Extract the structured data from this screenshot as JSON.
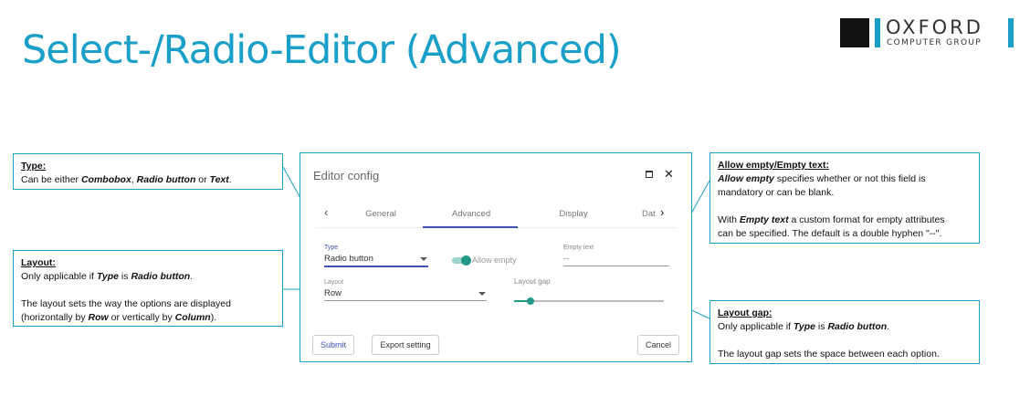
{
  "slide": {
    "title": "Select-/Radio-Editor (Advanced)"
  },
  "logo": {
    "name": "OXFORD",
    "subtitle": "COMPUTER GROUP"
  },
  "callouts": {
    "type": {
      "title": "Type:",
      "t1": "Can be either ",
      "e1": "Combobox",
      "t2": ", ",
      "e2": "Radio button",
      "t3": " or ",
      "e3": "Text",
      "t4": "."
    },
    "layout": {
      "title": "Layout:",
      "l1a": "Only applicable if ",
      "l1b": "Type",
      "l1c": " is ",
      "l1d": "Radio button",
      "l1e": ".",
      "l2": "The layout sets the way the options are displayed",
      "l3a": "(horizontally by ",
      "l3b": "Row",
      "l3c": " or vertically by ",
      "l3d": "Column",
      "l3e": ")."
    },
    "allow_empty": {
      "title": "Allow empty/Empty text:",
      "l1a": "Allow empty",
      "l1b": " specifies whether or not this field is",
      "l2": "mandatory or can be blank.",
      "l3a": "With ",
      "l3b": "Empty text",
      "l3c": " a custom format for empty attributes",
      "l4": "can be specified. The default is a double hyphen \"--\"."
    },
    "layout_gap": {
      "title": "Layout gap:",
      "l1a": "Only applicable if ",
      "l1b": "Type",
      "l1c": " is ",
      "l1d": "Radio button",
      "l1e": ".",
      "l2": "The layout gap sets the space between each option."
    }
  },
  "dialog": {
    "title": "Editor config",
    "tabs": [
      "General",
      "Advanced",
      "Display",
      "Dat"
    ],
    "active_tab": "Advanced",
    "accent_color": "#3f51b5",
    "toggle_color": "#24998a",
    "fields": {
      "type_label": "Type",
      "type_value": "Radio button",
      "allow_empty_label": "Allow empty",
      "allow_empty_checked": true,
      "empty_text_label": "Empty text",
      "empty_text_value": "--",
      "layout_label": "Layout",
      "layout_value": "Row",
      "layout_gap_label": "Layout gap"
    },
    "buttons": {
      "submit": "Submit",
      "export": "Export setting",
      "cancel": "Cancel"
    }
  },
  "colors": {
    "title": "#1aa0c8",
    "callout_border": "#1aa0c8"
  },
  "icons": {
    "maximize": "maximize-icon",
    "close": "close-icon",
    "tab_prev": "chevron-left-icon",
    "tab_next": "chevron-right-icon",
    "dropdown": "caret-down-icon"
  }
}
